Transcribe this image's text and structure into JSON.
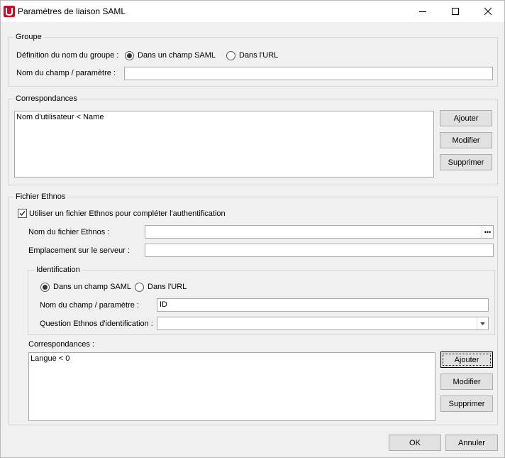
{
  "window": {
    "title": "Paramètres de liaison SAML"
  },
  "groupe": {
    "title": "Groupe",
    "definition_label": "Définition du nom du groupe :",
    "option_saml": "Dans un champ SAML",
    "option_url": "Dans l'URL",
    "selected": "saml",
    "field_label": "Nom du champ / paramètre :",
    "field_value": ""
  },
  "correspondances": {
    "title": "Correspondances",
    "items": [
      "Nom d'utilisateur < Name"
    ],
    "add_label": "Ajouter",
    "edit_label": "Modifier",
    "delete_label": "Supprimer"
  },
  "ethnos": {
    "title": "Fichier Ethnos",
    "use_label": "Utiliser un fichier Ethnos pour compléter l'authentification",
    "use_checked": true,
    "file_label": "Nom du fichier Ethnos :",
    "file_value": "",
    "location_label": "Emplacement sur le serveur :",
    "location_value": "",
    "identification": {
      "title": "Identification",
      "option_saml": "Dans un champ SAML",
      "option_url": "Dans l'URL",
      "selected": "saml",
      "field_label": "Nom du champ / paramètre :",
      "field_value": "ID",
      "question_label": "Question Ethnos d'identification :",
      "question_value": ""
    },
    "correspondances_label": "Correspondances :",
    "items": [
      "Langue < 0"
    ],
    "add_label": "Ajouter",
    "edit_label": "Modifier",
    "delete_label": "Supprimer"
  },
  "footer": {
    "ok_label": "OK",
    "cancel_label": "Annuler"
  },
  "colors": {
    "app_icon": "#c8102e"
  }
}
